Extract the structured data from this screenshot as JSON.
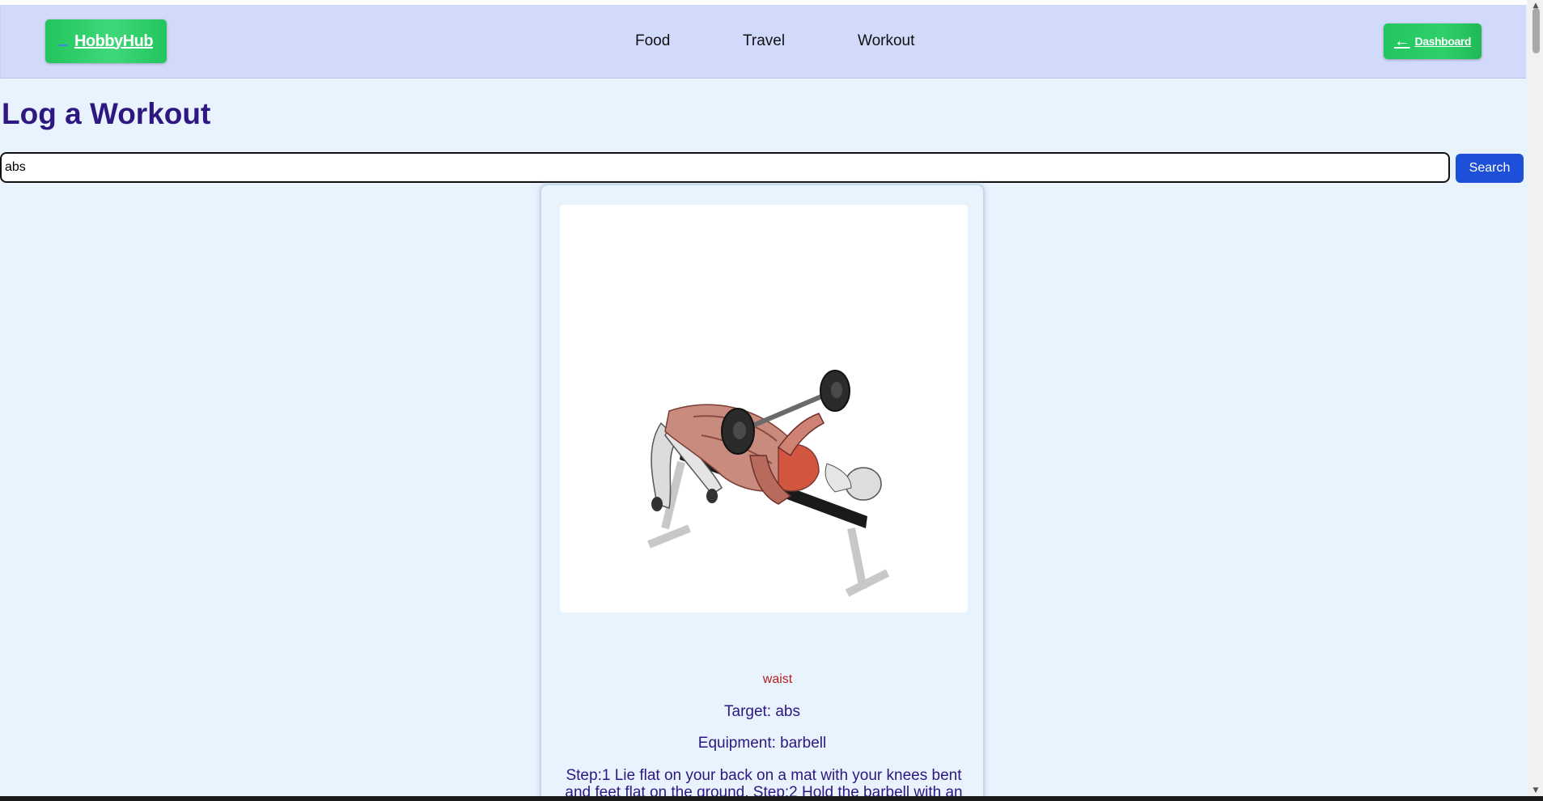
{
  "navbar": {
    "brand_label": "HobbyHub",
    "brand_icon": "logo-icon",
    "links": [
      "Food",
      "Travel",
      "Workout"
    ],
    "dashboard_label": "Dashboard",
    "dashboard_icon": "arrow-left-icon",
    "background_color": "#d1dafa",
    "button_color": "#22c55e"
  },
  "main": {
    "title": "Log a Workout",
    "search": {
      "value": "abs",
      "button_label": "Search",
      "button_color": "#1d4fd8"
    }
  },
  "result_card": {
    "image": "barbell-bench-exercise-illustration",
    "body_part": "waist",
    "target": "Target: abs",
    "equipment": "Equipment: barbell",
    "steps": "Step:1 Lie flat on your back on a mat with your knees bent and feet flat on the ground. Step:2 Hold the barbell with an"
  },
  "colors": {
    "page_background": "#e8f3fe",
    "title_color": "#2e1780",
    "body_part_color": "#b21f1f"
  }
}
